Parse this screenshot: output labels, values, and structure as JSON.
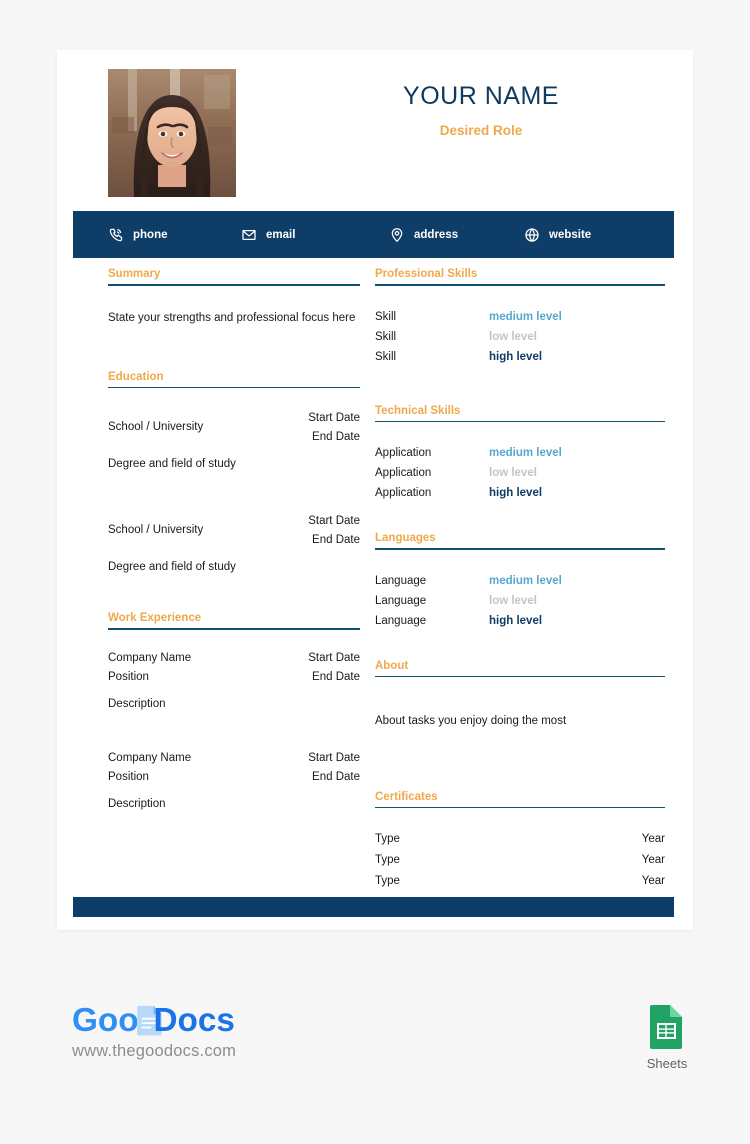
{
  "header": {
    "name": "YOUR NAME",
    "role": "Desired Role",
    "photo_alt": "portrait-photo"
  },
  "contact": {
    "items": [
      {
        "icon": "phone-icon",
        "label": "phone"
      },
      {
        "icon": "email-icon",
        "label": "email"
      },
      {
        "icon": "address-icon",
        "label": "address"
      },
      {
        "icon": "website-icon",
        "label": "website"
      }
    ]
  },
  "left_column": {
    "summary": {
      "title": "Summary",
      "text": "State your strengths and professional focus here"
    },
    "education": {
      "title": "Education",
      "entries": [
        {
          "school": "School / University",
          "start_date": "Start Date",
          "end_date": "End Date",
          "degree": "Degree and field of study"
        },
        {
          "school": "School / University",
          "start_date": "Start Date",
          "end_date": "End Date",
          "degree": "Degree and field of study"
        }
      ]
    },
    "work_experience": {
      "title": "Work Experience",
      "entries": [
        {
          "company": "Company Name",
          "position": "Position",
          "start_date": "Start Date",
          "end_date": "End Date",
          "description": "Description"
        },
        {
          "company": "Company Name",
          "position": "Position",
          "start_date": "Start Date",
          "end_date": "End Date",
          "description": "Description"
        }
      ]
    }
  },
  "right_column": {
    "professional_skills": {
      "title": "Professional Skills",
      "rows": [
        {
          "name": "Skill",
          "level": "medium level",
          "level_class": "lvl-medium"
        },
        {
          "name": "Skill",
          "level": "low level",
          "level_class": "lvl-low"
        },
        {
          "name": "Skill",
          "level": "high level",
          "level_class": "lvl-high"
        }
      ]
    },
    "technical_skills": {
      "title": "Technical Skills",
      "rows": [
        {
          "name": "Application",
          "level": "medium level",
          "level_class": "lvl-medium"
        },
        {
          "name": "Application",
          "level": "low level",
          "level_class": "lvl-low"
        },
        {
          "name": "Application",
          "level": "high level",
          "level_class": "lvl-high"
        }
      ]
    },
    "languages": {
      "title": "Languages",
      "rows": [
        {
          "name": "Language",
          "level": "medium level",
          "level_class": "lvl-medium"
        },
        {
          "name": "Language",
          "level": "low level",
          "level_class": "lvl-low"
        },
        {
          "name": "Language",
          "level": "high level",
          "level_class": "lvl-high"
        }
      ]
    },
    "about": {
      "title": "About",
      "text": "About tasks you enjoy doing the most"
    },
    "certificates": {
      "title": "Certificates",
      "rows": [
        {
          "type": "Type",
          "year": "Year"
        },
        {
          "type": "Type",
          "year": "Year"
        },
        {
          "type": "Type",
          "year": "Year"
        }
      ]
    }
  },
  "branding": {
    "logo_text_goo": "Goo",
    "logo_text_docs": "Docs",
    "url": "www.thegoodocs.com",
    "product_label": "Sheets"
  },
  "colors": {
    "navy": "#0e3d68",
    "rule": "#0e5173",
    "accent_orange": "#efa94a",
    "name_navy": "#0f3a5f",
    "level_medium": "#56a8cf",
    "level_low": "#c4c4c4",
    "level_high": "#0e3d68",
    "page_background": "#f7f7f7",
    "sheets_green": "#21a366"
  }
}
